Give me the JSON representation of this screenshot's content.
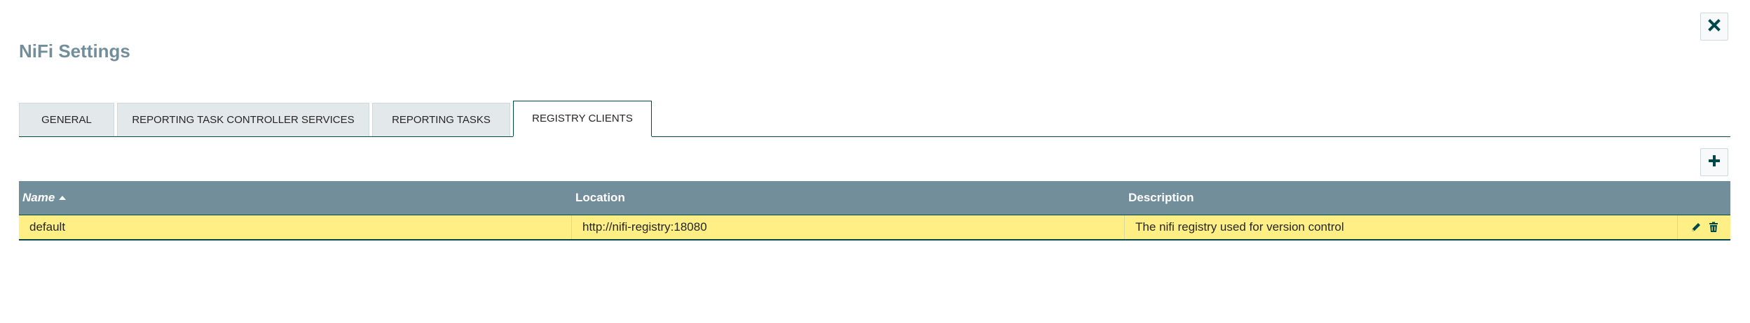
{
  "dialog": {
    "title": "NiFi Settings",
    "close_icon": "close-icon"
  },
  "tabs": [
    {
      "label": "GENERAL",
      "active": false
    },
    {
      "label": "REPORTING TASK CONTROLLER SERVICES",
      "active": false
    },
    {
      "label": "REPORTING TASKS",
      "active": false
    },
    {
      "label": "REGISTRY CLIENTS",
      "active": true
    }
  ],
  "toolbar": {
    "add_icon": "plus-icon"
  },
  "table": {
    "columns": [
      {
        "label": "Name",
        "sorted": "ascending"
      },
      {
        "label": "Location"
      },
      {
        "label": "Description"
      }
    ],
    "rows": [
      {
        "name": "default",
        "location": "http://nifi-registry:18080",
        "description": "The nifi registry used for version control",
        "action_icons": [
          "pencil-icon",
          "trash-icon"
        ]
      }
    ]
  },
  "colors": {
    "title": "#728e9b",
    "header_bg": "#728e9b",
    "selected_row_bg": "#ffef85",
    "accent": "#004849"
  }
}
